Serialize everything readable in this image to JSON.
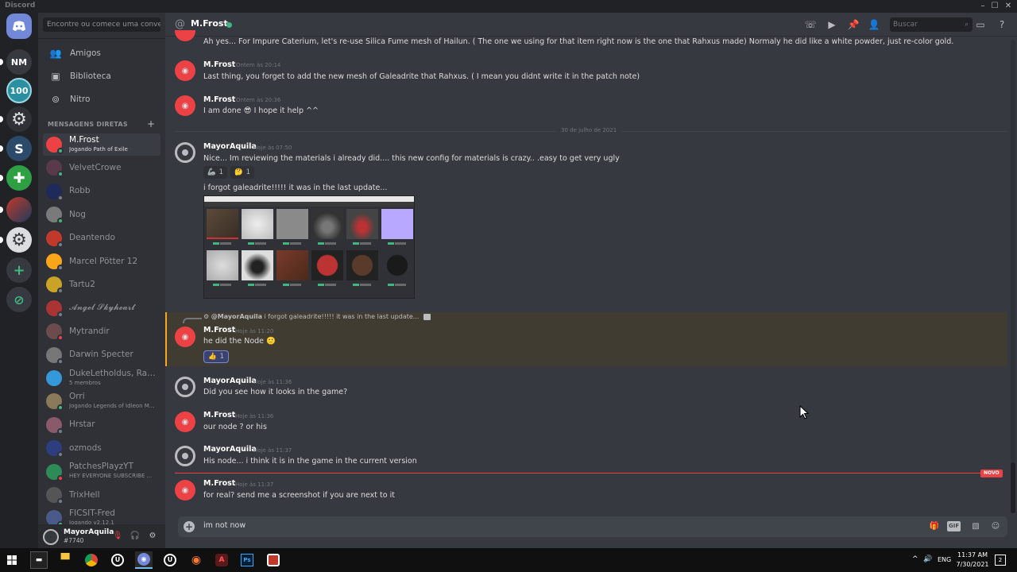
{
  "app": {
    "title": "Discord",
    "colors": {
      "accent": "#7289da",
      "online": "#43b581",
      "mention_bg": "#413c31",
      "mention_bar": "#faa61a",
      "new_line": "#ed4245"
    }
  },
  "window_controls": {
    "minimize": "–",
    "maximize": "☐",
    "close": "✕"
  },
  "guild_rail": {
    "nm_label": "NM",
    "server_100_label": "100",
    "server_s_label": "S",
    "add_server": "+"
  },
  "sidebar": {
    "search_placeholder": "Encontre ou comece uma conversa",
    "nav": [
      {
        "label": "Amigos",
        "icon": "friends-icon"
      },
      {
        "label": "Biblioteca",
        "icon": "library-icon"
      },
      {
        "label": "Nitro",
        "icon": "nitro-icon"
      }
    ],
    "dm_header": "MENSAGENS DIRETAS",
    "dm_add": "+",
    "dms": [
      {
        "name": "M.Frost",
        "sub": "Jogando Path of Exile",
        "color": "#ed4245",
        "status": "#43b581",
        "active": true
      },
      {
        "name": "VelvetCrowe",
        "sub": "",
        "color": "#5a3a4a",
        "status": "#43b581"
      },
      {
        "name": "Robb",
        "sub": "",
        "color": "#1e2a5a",
        "status": "#747f8d"
      },
      {
        "name": "Nog",
        "sub": "",
        "color": "#7a7a7a",
        "status": "#43b581"
      },
      {
        "name": "Deantendo",
        "sub": "",
        "color": "#c0392b",
        "status": "#747f8d",
        "initials": "DEAN TENDO"
      },
      {
        "name": "Marcel Pötter 12",
        "sub": "",
        "color": "#faa61a",
        "status": "#747f8d"
      },
      {
        "name": "Tartu2",
        "sub": "",
        "color": "#c9a227",
        "status": "#747f8d"
      },
      {
        "name": "𝓐𝓷𝓰𝓮𝓵 𝓢𝓴𝔂𝓱𝓮𝓪𝓻𝓽",
        "sub": "",
        "color": "#a33",
        "status": "#747f8d"
      },
      {
        "name": "Mytrandir",
        "sub": "",
        "color": "#6b4b4b",
        "status": "#ed4245"
      },
      {
        "name": "Darwin Specter",
        "sub": "",
        "color": "#777",
        "status": "#747f8d"
      },
      {
        "name": "DukeLetholdus, Rahx...",
        "sub": "5 membros",
        "color": "#3498db",
        "status": ""
      },
      {
        "name": "Orri",
        "sub": "Jogando Legends of Idleon M...",
        "color": "#8a7a5a",
        "status": "#43b581"
      },
      {
        "name": "Hrstar",
        "sub": "",
        "color": "#8a5a6a",
        "status": "#747f8d"
      },
      {
        "name": "ozmods",
        "sub": "",
        "color": "#2c3e80",
        "status": "#747f8d"
      },
      {
        "name": "PatchesPlayzYT",
        "sub": "HEY EVERYONE SUBSCRIBE ...",
        "color": "#2e8b57",
        "status": "#ed4245"
      },
      {
        "name": "TrixHell",
        "sub": "",
        "color": "#555",
        "status": "#747f8d"
      },
      {
        "name": "FICSIT-Fred",
        "sub": "Jogando v2.12.1",
        "color": "#4a5a8a",
        "status": "#43b581"
      }
    ]
  },
  "user_panel": {
    "username": "MayorAquila",
    "tag": "#7740"
  },
  "header": {
    "at_symbol": "@",
    "name": "M.Frost",
    "search_placeholder": "Buscar",
    "icons": [
      "call-icon",
      "video-icon",
      "pin-icon",
      "add-friend-icon",
      "inbox-icon",
      "help-icon"
    ]
  },
  "messages": {
    "m0": {
      "text": "Ah yes... For Impure Caterium, let's re-use Silica Fume mesh of Hailun. ( The one we using for that item right now is the one that Rahxus made)   Normaly he did like a white powder, just re-color gold."
    },
    "m1": {
      "author": "M.Frost",
      "time": "Ontem às 20:14",
      "text": "Last thing, you forget to add the new mesh of Galeadrite that Rahxus. ( I mean you didnt write it in the patch note)"
    },
    "m2": {
      "author": "M.Frost",
      "time": "Ontem às 20:36",
      "text_a": "I am done",
      "emoji": "😎",
      "text_b": "I hope it help ^^"
    },
    "day_divider": "30 de julho de 2021",
    "m3": {
      "author": "MayorAquila",
      "time": "Hoje às 07:50",
      "text": "Nice... Im reviewing the materials i already did.... this new config for materials is crazy.. .easy to get very ugly",
      "reactions": [
        {
          "emoji": "🦾",
          "count": "1"
        },
        {
          "emoji": "🤔",
          "count": "1"
        }
      ],
      "text2": "i forgot galeadrite!!!!! it was in the last update..."
    },
    "m4": {
      "reply_mention": "@MayorAquila",
      "reply_text": "i forgot galeadrite!!!!! it was in the last update...",
      "author": "M.Frost",
      "time": "Hoje às 11:20",
      "text": "he did the Node",
      "emoji": "🙂",
      "reaction": {
        "emoji": "👍",
        "count": "1"
      }
    },
    "m5": {
      "author": "MayorAquila",
      "time": "Hoje às 11:36",
      "text": "Did you see how it looks in the game?"
    },
    "m6": {
      "author": "M.Frost",
      "time": "Hoje às 11:36",
      "text": "our node ? or his"
    },
    "m7": {
      "author": "MayorAquila",
      "time": "Hoje às 11:37",
      "text": "His node... i think it is in the game in the current version"
    },
    "new_badge": "NOVO",
    "m8": {
      "author": "M.Frost",
      "time": "Hoje às 11:37",
      "text": "for real?  send me a screenshot if you are next to it"
    }
  },
  "composer": {
    "value": "im not now",
    "gif_label": "GIF"
  },
  "taskbar": {
    "lang": "ENG",
    "time": "11:37 AM",
    "date": "7/30/2021",
    "notif_count": "2",
    "apps": [
      "windows-start-icon",
      "terminal-icon",
      "file-explorer-icon",
      "chrome-icon",
      "unreal-engine-icon",
      "discord-icon",
      "unreal-engine-icon",
      "blender-icon",
      "app-a-icon",
      "photoshop-icon",
      "app-red-icon"
    ]
  }
}
